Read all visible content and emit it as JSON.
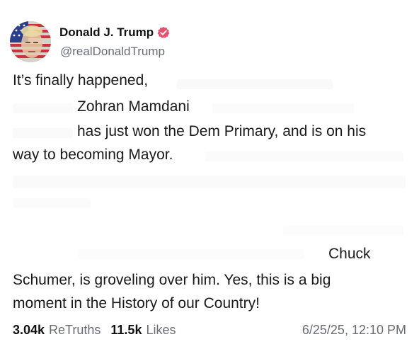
{
  "author": {
    "name": "Donald J. Trump",
    "handle": "@realDonaldTrump",
    "avatar_icon": "flag-portrait-avatar",
    "verified_icon": "verified-badge-icon",
    "verified_color": "#e5526f"
  },
  "post": {
    "lines": [
      "It’s finally happened,",
      "Zohran Mamdani",
      "has just won the Dem Primary, and is on his",
      "way to becoming Mayor.",
      "Chuck",
      "Schumer, is groveling over him. Yes, this is a big",
      "moment in the History of our Country!"
    ]
  },
  "stats": {
    "retruths_count": "3.04k",
    "retruths_label": "ReTruths",
    "likes_count": "11.5k",
    "likes_label": "Likes",
    "timestamp": "6/25/25, 12:10 PM"
  }
}
